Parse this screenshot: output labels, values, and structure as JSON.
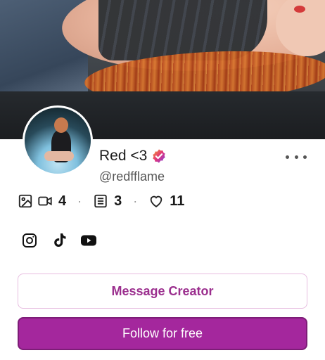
{
  "profile": {
    "display_name": "Red <3",
    "handle": "@redfflame",
    "verified": true
  },
  "stats": {
    "media_count": "4",
    "posts_count": "3",
    "likes_count": "11",
    "separator": "·"
  },
  "socials": [
    "instagram-icon",
    "tiktok-icon",
    "youtube-icon"
  ],
  "actions": {
    "message_label": "Message Creator",
    "follow_label": "Follow for free"
  },
  "colors": {
    "accent": "#a4279d",
    "accent_text": "#9b2f8e",
    "verified_badge": "#7b3fe4"
  }
}
